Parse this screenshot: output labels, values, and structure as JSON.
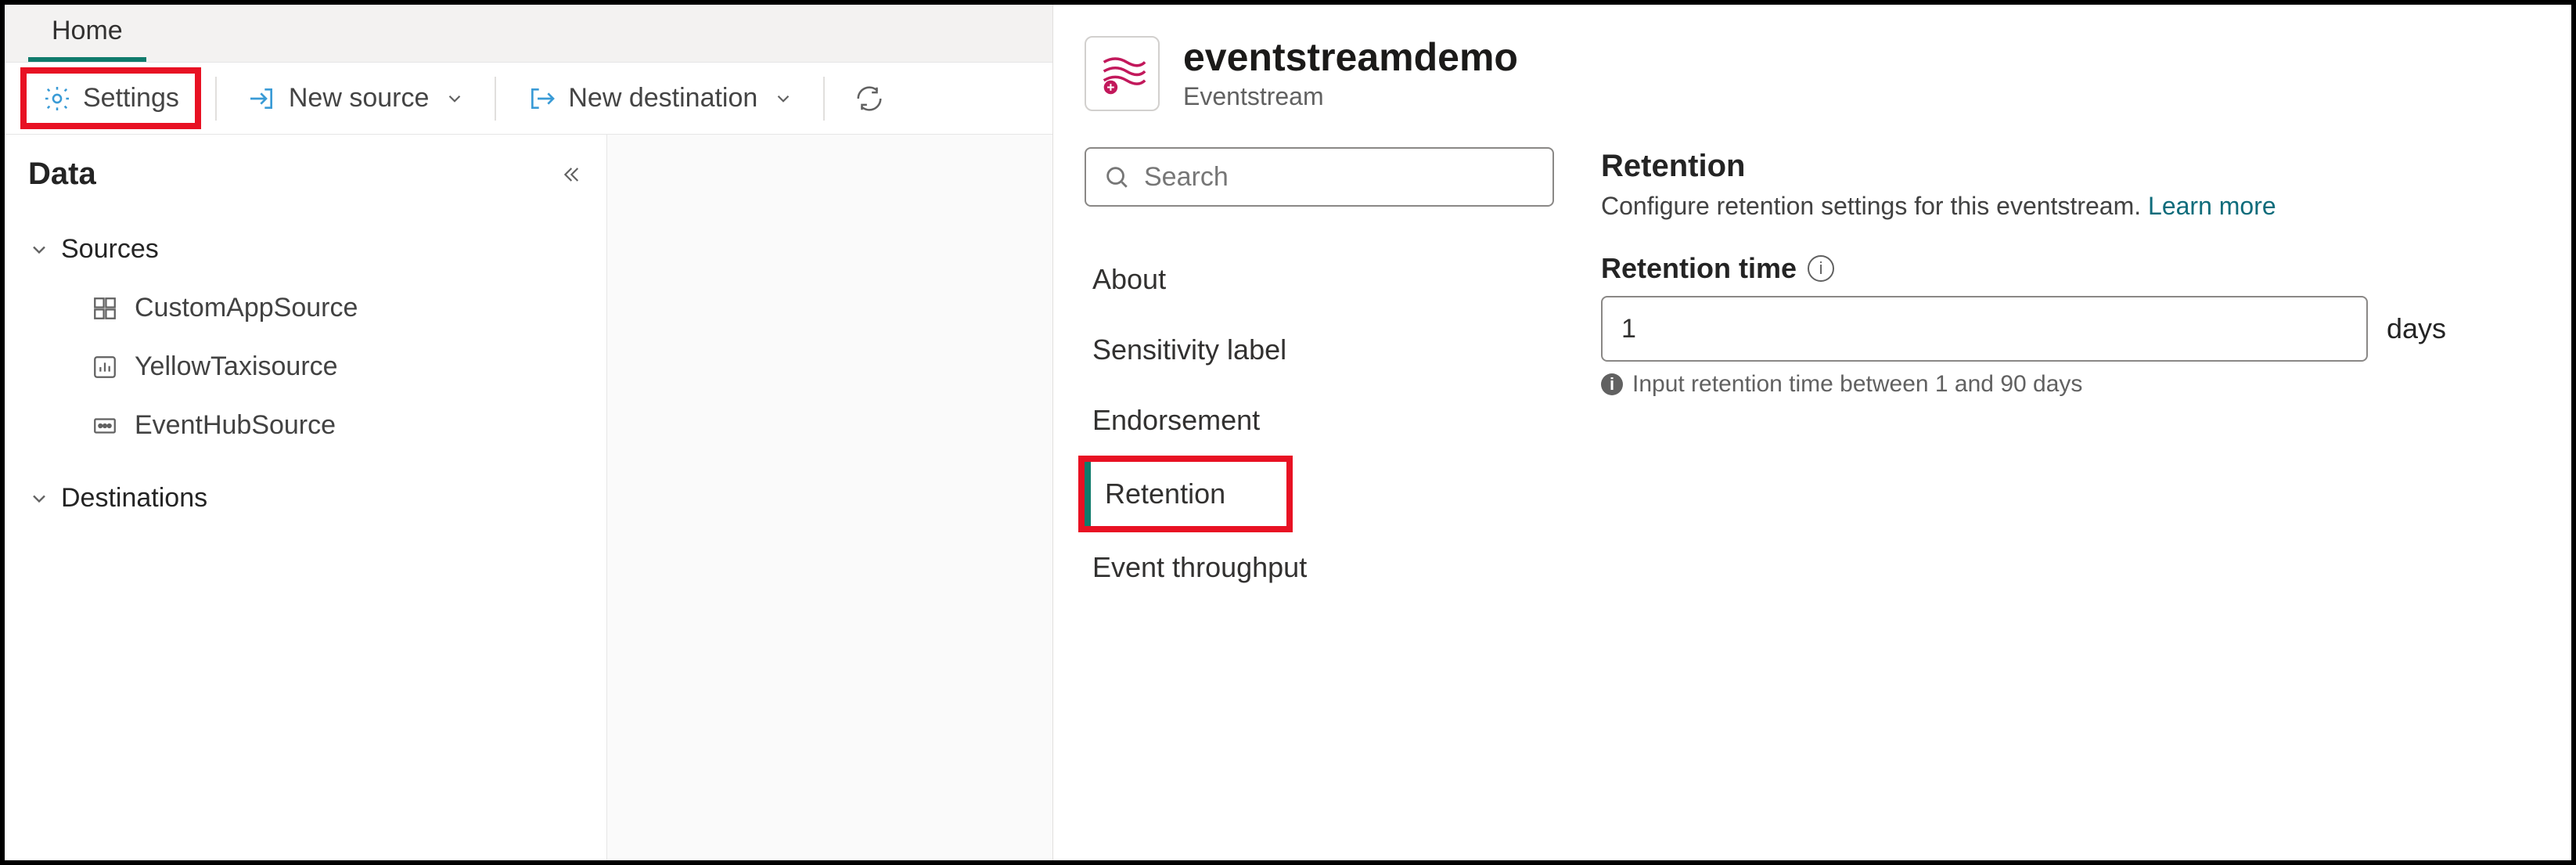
{
  "tabs": {
    "home": "Home"
  },
  "toolbar": {
    "settings": "Settings",
    "new_source": "New source",
    "new_destination": "New destination"
  },
  "data_pane": {
    "title": "Data",
    "sources_label": "Sources",
    "destinations_label": "Destinations",
    "sources": [
      {
        "label": "CustomAppSource",
        "icon": "app-icon"
      },
      {
        "label": "YellowTaxisource",
        "icon": "chart-icon"
      },
      {
        "label": "EventHubSource",
        "icon": "eventhub-icon"
      }
    ]
  },
  "panel": {
    "title": "eventstreamdemo",
    "subtitle": "Eventstream",
    "search_placeholder": "Search",
    "nav": {
      "about": "About",
      "sensitivity": "Sensitivity label",
      "endorsement": "Endorsement",
      "retention": "Retention",
      "throughput": "Event throughput"
    },
    "retention_section": {
      "title": "Retention",
      "desc": "Configure retention settings for this eventstream.",
      "learn_more": "Learn more",
      "field_label": "Retention time",
      "value": "1",
      "unit": "days",
      "hint": "Input retention time between 1 and 90 days"
    }
  }
}
